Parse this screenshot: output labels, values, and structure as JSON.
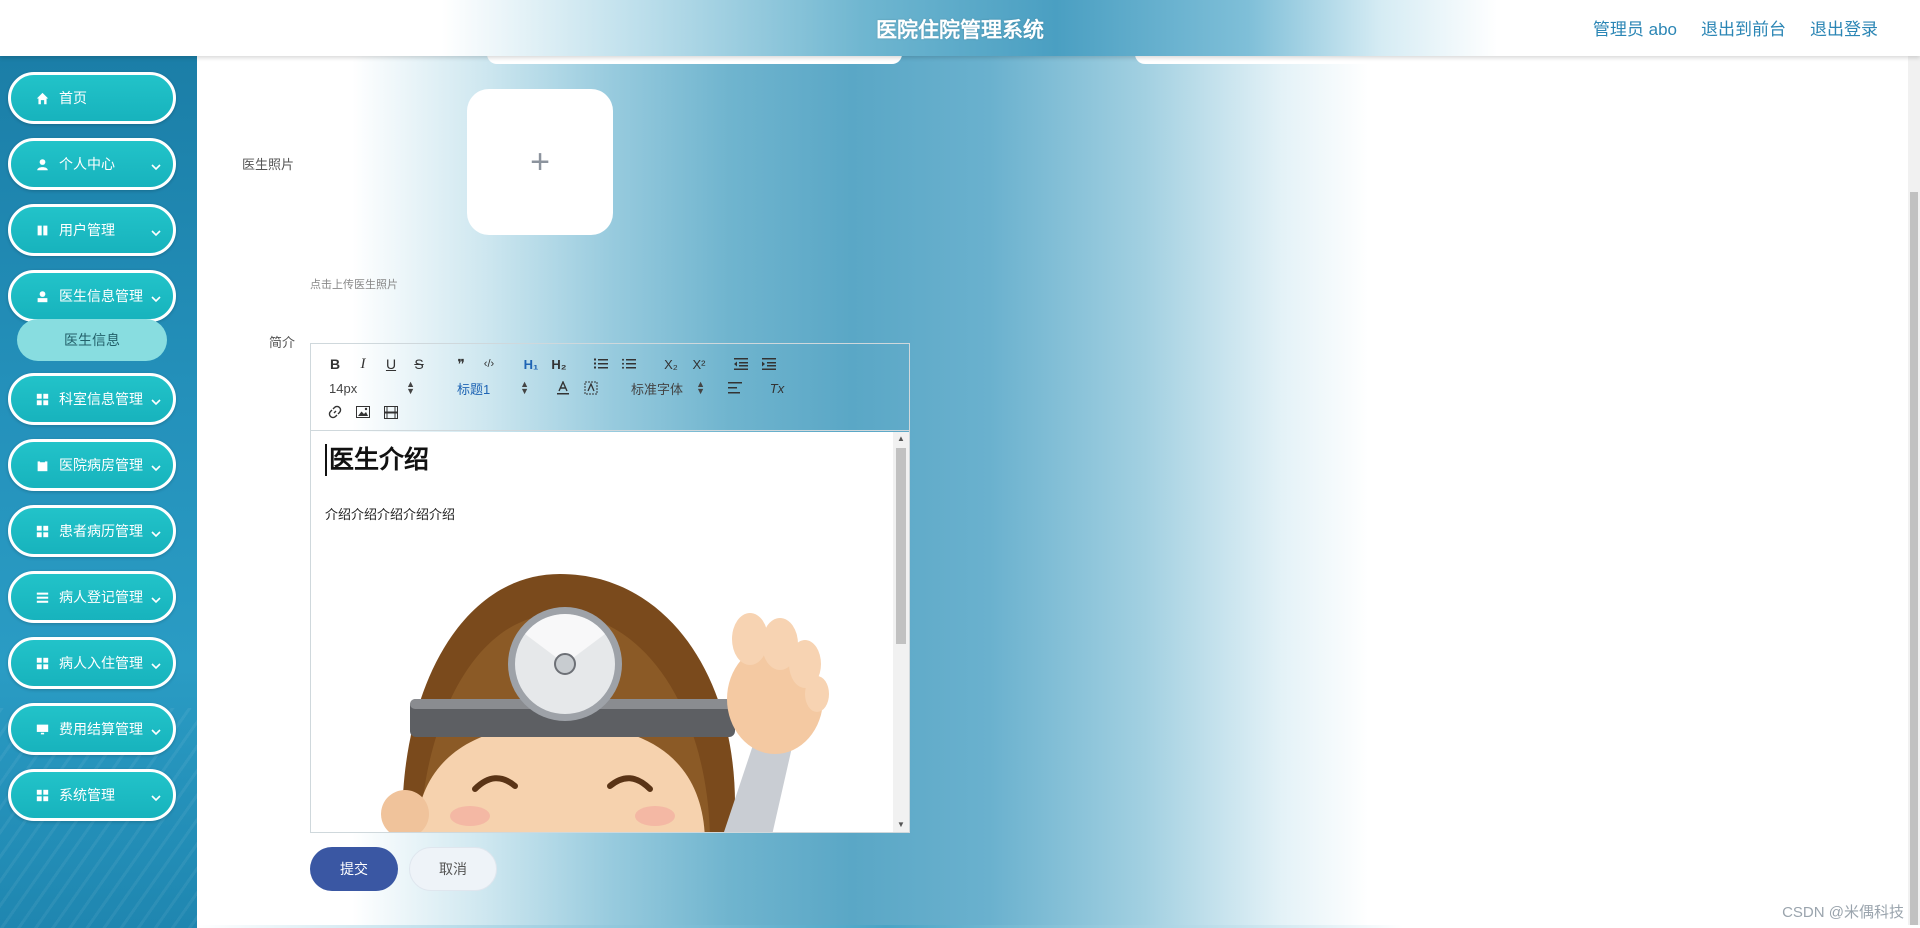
{
  "app": {
    "title": "医院住院管理系统"
  },
  "top_links": {
    "user": "管理员 abo",
    "front": "退出到前台",
    "logout": "退出登录"
  },
  "sidebar": {
    "items": [
      {
        "label": "首页",
        "icon": "home-icon",
        "expandable": false
      },
      {
        "label": "个人中心",
        "icon": "user-icon",
        "expandable": true
      },
      {
        "label": "用户管理",
        "icon": "book-icon",
        "expandable": true
      },
      {
        "label": "医生信息管理",
        "icon": "user-badge-icon",
        "expandable": true
      },
      {
        "label": "科室信息管理",
        "icon": "grid-icon",
        "expandable": true
      },
      {
        "label": "医院病房管理",
        "icon": "clipboard-icon",
        "expandable": true
      },
      {
        "label": "患者病历管理",
        "icon": "grid-icon",
        "expandable": true
      },
      {
        "label": "病人登记管理",
        "icon": "list-icon",
        "expandable": true
      },
      {
        "label": "病人入住管理",
        "icon": "grid-icon",
        "expandable": true
      },
      {
        "label": "费用结算管理",
        "icon": "monitor-icon",
        "expandable": true
      },
      {
        "label": "系统管理",
        "icon": "grid-icon",
        "expandable": true
      }
    ],
    "submenu": {
      "label": "医生信息"
    }
  },
  "form": {
    "photo_label": "医生照片",
    "upload_plus": "+",
    "upload_tip": "点击上传医生照片",
    "intro_label": "简介"
  },
  "editor": {
    "toolbar": {
      "bold": "B",
      "italic": "I",
      "underline": "U",
      "strike": "S",
      "quote": "❞",
      "code": "‹/›",
      "h1": "H₁",
      "h2": "H₂",
      "subscript": "X₂",
      "superscript": "X²",
      "size_value": "14px",
      "header_value": "标题1",
      "font_value": "标准字体",
      "clean": "Tx"
    },
    "content": {
      "heading": "医生介绍",
      "paragraph": "介绍介绍介绍介绍介绍"
    }
  },
  "buttons": {
    "submit": "提交",
    "cancel": "取消"
  },
  "watermark": "CSDN @米偶科技",
  "colors": {
    "menu_bg": "#1bbac4",
    "submenu_bg": "#88dde0",
    "primary": "#3a57a3",
    "link": "#2b86b5"
  }
}
